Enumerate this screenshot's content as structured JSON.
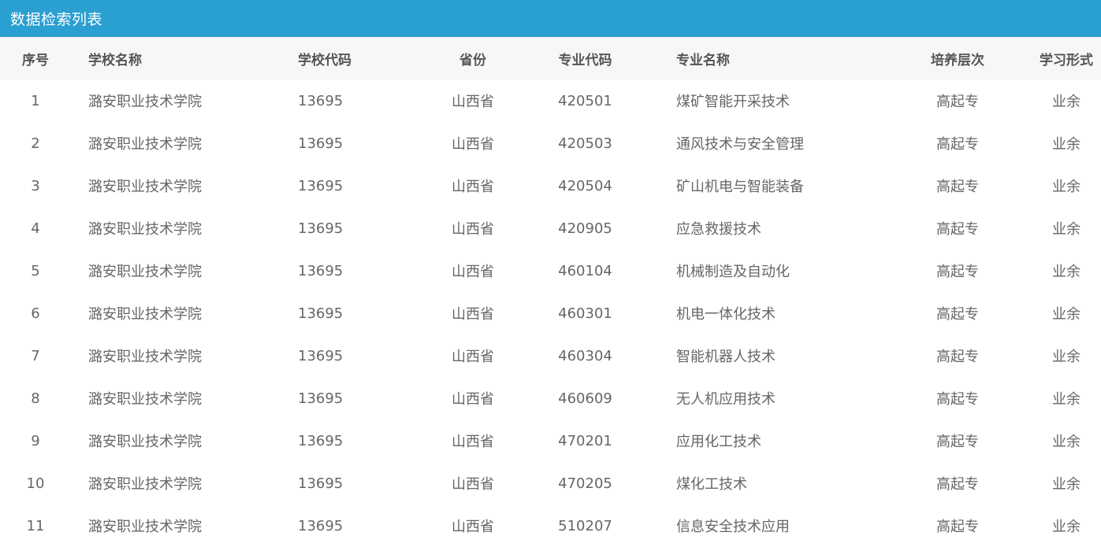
{
  "panel": {
    "title": "数据检索列表"
  },
  "table": {
    "headers": {
      "index": "序号",
      "school_name": "学校名称",
      "school_code": "学校代码",
      "province": "省份",
      "major_code": "专业代码",
      "major_name": "专业名称",
      "level": "培养层次",
      "study_mode": "学习形式"
    },
    "rows": [
      {
        "index": "1",
        "school_name": "潞安职业技术学院",
        "school_code": "13695",
        "province": "山西省",
        "major_code": "420501",
        "major_name": "煤矿智能开采技术",
        "level": "高起专",
        "study_mode": "业余"
      },
      {
        "index": "2",
        "school_name": "潞安职业技术学院",
        "school_code": "13695",
        "province": "山西省",
        "major_code": "420503",
        "major_name": "通风技术与安全管理",
        "level": "高起专",
        "study_mode": "业余"
      },
      {
        "index": "3",
        "school_name": "潞安职业技术学院",
        "school_code": "13695",
        "province": "山西省",
        "major_code": "420504",
        "major_name": "矿山机电与智能装备",
        "level": "高起专",
        "study_mode": "业余"
      },
      {
        "index": "4",
        "school_name": "潞安职业技术学院",
        "school_code": "13695",
        "province": "山西省",
        "major_code": "420905",
        "major_name": "应急救援技术",
        "level": "高起专",
        "study_mode": "业余"
      },
      {
        "index": "5",
        "school_name": "潞安职业技术学院",
        "school_code": "13695",
        "province": "山西省",
        "major_code": "460104",
        "major_name": "机械制造及自动化",
        "level": "高起专",
        "study_mode": "业余"
      },
      {
        "index": "6",
        "school_name": "潞安职业技术学院",
        "school_code": "13695",
        "province": "山西省",
        "major_code": "460301",
        "major_name": "机电一体化技术",
        "level": "高起专",
        "study_mode": "业余"
      },
      {
        "index": "7",
        "school_name": "潞安职业技术学院",
        "school_code": "13695",
        "province": "山西省",
        "major_code": "460304",
        "major_name": "智能机器人技术",
        "level": "高起专",
        "study_mode": "业余"
      },
      {
        "index": "8",
        "school_name": "潞安职业技术学院",
        "school_code": "13695",
        "province": "山西省",
        "major_code": "460609",
        "major_name": "无人机应用技术",
        "level": "高起专",
        "study_mode": "业余"
      },
      {
        "index": "9",
        "school_name": "潞安职业技术学院",
        "school_code": "13695",
        "province": "山西省",
        "major_code": "470201",
        "major_name": "应用化工技术",
        "level": "高起专",
        "study_mode": "业余"
      },
      {
        "index": "10",
        "school_name": "潞安职业技术学院",
        "school_code": "13695",
        "province": "山西省",
        "major_code": "470205",
        "major_name": "煤化工技术",
        "level": "高起专",
        "study_mode": "业余"
      },
      {
        "index": "11",
        "school_name": "潞安职业技术学院",
        "school_code": "13695",
        "province": "山西省",
        "major_code": "510207",
        "major_name": "信息安全技术应用",
        "level": "高起专",
        "study_mode": "业余"
      }
    ]
  },
  "colors": {
    "header_bar": "#2a9fd1",
    "header_row_bg": "#f7f7f7",
    "text": "#666666"
  }
}
